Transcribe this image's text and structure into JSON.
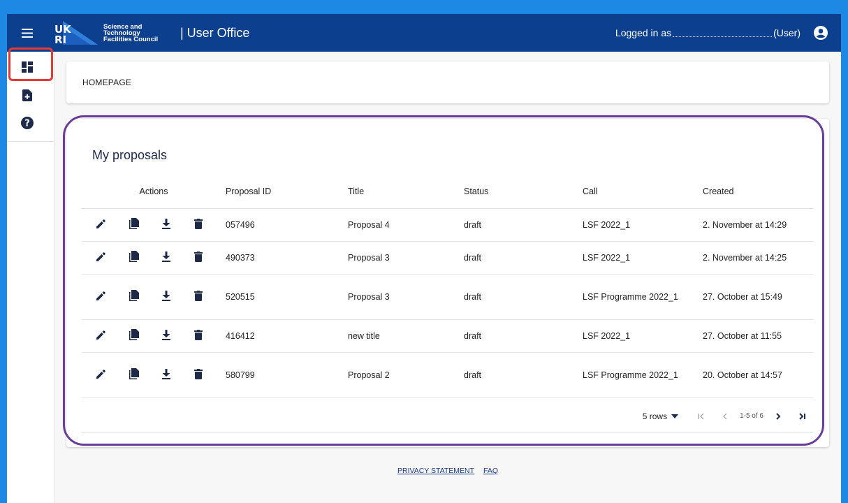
{
  "appbar": {
    "logo_text_lines": [
      "Science and",
      "Technology",
      "Facilities Council"
    ],
    "logo_mark": "UKRI",
    "title": "| User Office",
    "logged_in_label": "Logged in as",
    "role": "(User)"
  },
  "sidebar": {
    "items": [
      {
        "icon": "dashboard-icon"
      },
      {
        "icon": "new-proposal-icon"
      },
      {
        "icon": "help-icon"
      }
    ]
  },
  "breadcrumb": "HOMEPAGE",
  "proposals": {
    "title": "My proposals",
    "columns": [
      "Actions",
      "Proposal ID",
      "Title",
      "Status",
      "Call",
      "Created"
    ],
    "rows": [
      {
        "id": "057496",
        "title": "Proposal 4",
        "status": "draft",
        "call": "LSF 2022_1",
        "created": "2. November at 14:29"
      },
      {
        "id": "490373",
        "title": "Proposal 3",
        "status": "draft",
        "call": "LSF 2022_1",
        "created": "2. November at 14:25"
      },
      {
        "id": "520515",
        "title": "Proposal 3",
        "status": "draft",
        "call": "LSF Programme 2022_1",
        "created": "27. October at 15:49"
      },
      {
        "id": "416412",
        "title": "new title",
        "status": "draft",
        "call": "LSF 2022_1",
        "created": "27. October at 11:55"
      },
      {
        "id": "580799",
        "title": "Proposal 2",
        "status": "draft",
        "call": "LSF Programme 2022_1",
        "created": "20. October at 14:57"
      }
    ],
    "pager": {
      "rows_label": "5 rows",
      "range": "1-5 of 6"
    }
  },
  "footer": {
    "privacy": "PRIVACY STATEMENT",
    "faq": "FAQ"
  },
  "colors": {
    "appbar": "#0d3f8f",
    "outer": "#1e88e5",
    "highlight_red": "#e53935",
    "highlight_purple": "#6a3d9a"
  }
}
